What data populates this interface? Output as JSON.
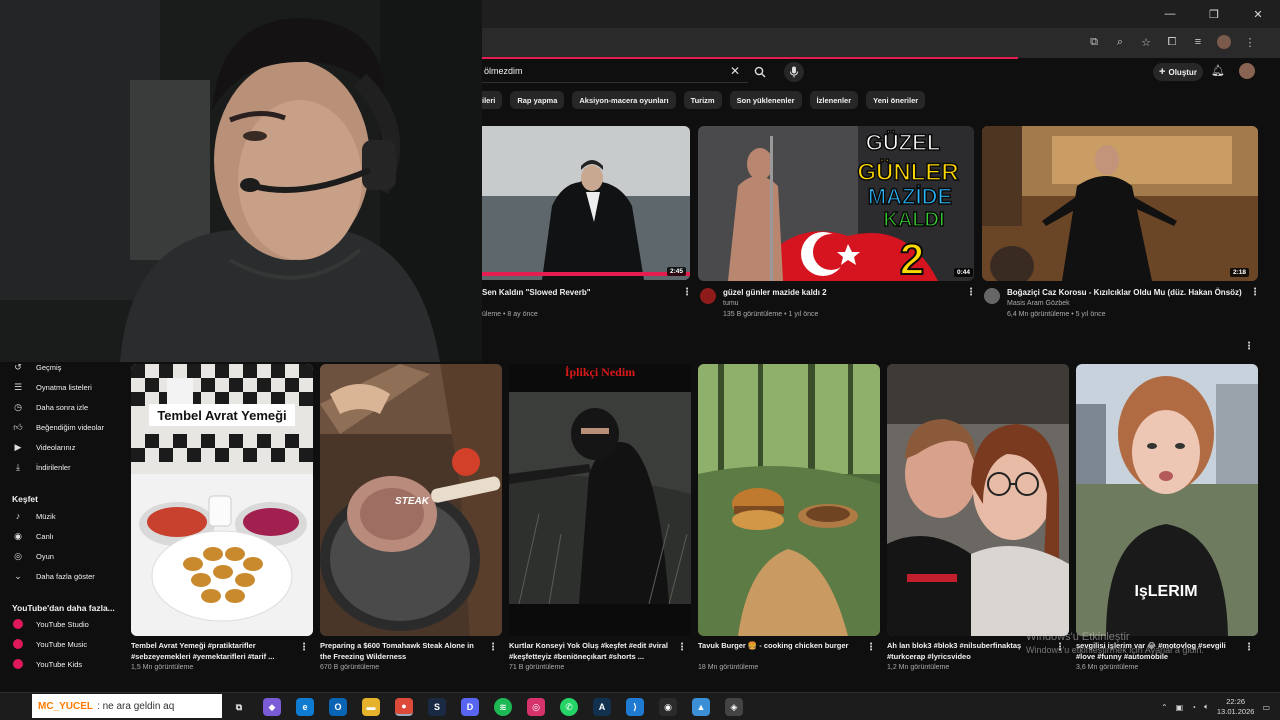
{
  "header": {
    "search_value": "ölmezdim",
    "create_label": "Oluştur"
  },
  "chips": [
    "ileri",
    "Rap yapma",
    "Aksiyon-macera oyunları",
    "Turizm",
    "Son yüklenenler",
    "İzlenenler",
    "Yeni öneriler"
  ],
  "videos": [
    {
      "title": "Sen Kaldın \"Slowed Reverb\"",
      "channel": "",
      "meta": "üleme • 8 ay önce",
      "duration": "2:45"
    },
    {
      "title": "güzel günler mazide kaldı 2",
      "channel": "tumu",
      "meta": "135 B görüntüleme • 1 yıl önce",
      "duration": "0:44",
      "thumb_text": [
        "GÜZEL",
        "GÜNLER",
        "MAZİDE",
        "KALDI",
        "2"
      ]
    },
    {
      "title": "Boğaziçi Caz Korosu - Kızılcıklar Oldu Mu (düz. Hakan Önsöz)",
      "channel": "Masis Aram Gözbek",
      "meta": "6,4 Mn görüntüleme • 5 yıl önce",
      "duration": "2:18"
    }
  ],
  "sidebar": {
    "you_items": [
      "Geçmiş",
      "Oynatma listeleri",
      "Daha sonra izle",
      "Beğendiğim videolar",
      "Videolarınız",
      "İndirilenler"
    ],
    "explore_title": "Keşfet",
    "explore_items": [
      "Müzik",
      "Canlı",
      "Oyun",
      "Daha fazla göster"
    ],
    "more_title": "YouTube'dan daha fazla...",
    "more_items": [
      "YouTube Studio",
      "YouTube Music",
      "YouTube Kids"
    ]
  },
  "shorts": [
    {
      "title": "Tembel Avrat Yemeği #pratiktarifler\n#sebzeyemekleri #yemektarifleri #tarif ...",
      "views": "1,5 Mn görüntüleme",
      "thumb_text": "Tembel Avrat Yemeği"
    },
    {
      "title": "Preparing a $600 Tomahawk Steak Alone in\nthe Freezing Wilderness",
      "views": "670 B görüntüleme",
      "thumb_text": "STEAK"
    },
    {
      "title": "Kurtlar Konseyi Yok Oluş #keşfet #edit #viral\n#keşfetteyiz #beniöneçıkart #shorts ...",
      "views": "71 B görüntüleme",
      "thumb_text": "İplikçi Nedim"
    },
    {
      "title": "Tavuk Burger 🍔 - cooking chicken burger",
      "views": "18 Mn görüntüleme",
      "thumb_text": ""
    },
    {
      "title": "Ah lan blok3 #blok3 #nilsuberfinaktaş\n#turkcerap #lyricsvideo",
      "views": "1,2 Mn görüntüleme",
      "thumb_text": ""
    },
    {
      "title": "sevgilisi işlerim var 😂 #motovlog #sevgili\n#love #funny #automobile",
      "views": "3,6 Mn görüntüleme",
      "thumb_text": "IşLERIM"
    }
  ],
  "overlay": {
    "chat_user": "MC_YUCEL",
    "chat_message": ": ne ara geldin aq",
    "activate_line1": "Windows'u Etkinleştir",
    "activate_line2": "Windows'u etkinleştirmek için Ayarlar'a gidin."
  },
  "taskbar": {
    "time": "22:26",
    "date": "13.01.2026"
  },
  "colors": {
    "accent": "#e51e52",
    "background": "#0f0f0f",
    "chip": "#272727"
  }
}
